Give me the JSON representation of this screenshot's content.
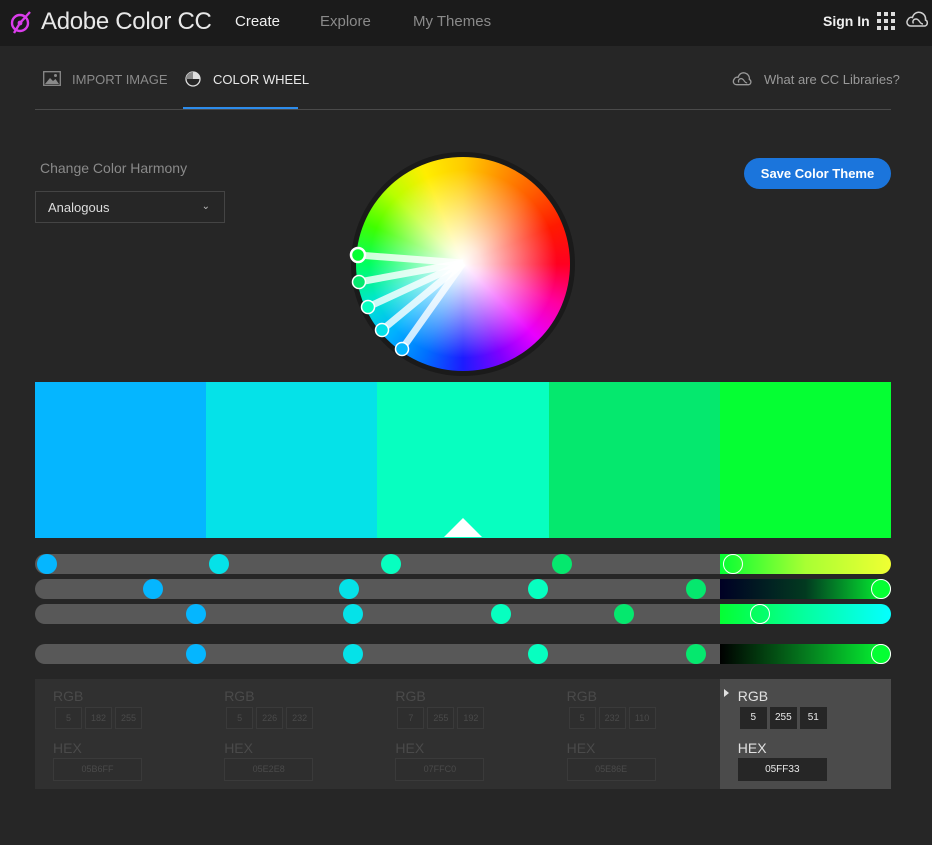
{
  "app": {
    "title": "Adobe Color CC"
  },
  "nav": {
    "create": "Create",
    "explore": "Explore",
    "my_themes": "My Themes",
    "sign_in": "Sign In"
  },
  "tabs": {
    "import_image": "IMPORT IMAGE",
    "color_wheel": "COLOR WHEEL",
    "active": "COLOR WHEEL",
    "cc_libraries": "What are CC Libraries?"
  },
  "harmony": {
    "label": "Change Color Harmony",
    "selected": "Analogous"
  },
  "save_button": "Save Color Theme",
  "colors": {
    "accent": "#1B75DC",
    "tab_underline": "#2D8CEB",
    "background": "#262626",
    "topbar": "#1B1B1B",
    "logo": "#DA3DEB"
  },
  "swatches": [
    {
      "hex": "05B6FF",
      "rgb": [
        "5",
        "182",
        "255"
      ],
      "css": "#05B6FF"
    },
    {
      "hex": "05E2E8",
      "rgb": [
        "5",
        "226",
        "232"
      ],
      "css": "#05E2E8"
    },
    {
      "hex": "07FFC0",
      "rgb": [
        "7",
        "255",
        "192"
      ],
      "css": "#07FFC0"
    },
    {
      "hex": "05E86E",
      "rgb": [
        "5",
        "232",
        "110"
      ],
      "css": "#05E86E"
    },
    {
      "hex": "05FF33",
      "rgb": [
        "5",
        "255",
        "51"
      ],
      "css": "#05FF33"
    }
  ],
  "base_swatch_index": 2,
  "selected_swatch_index": 4,
  "labels": {
    "rgb": "RGB",
    "hex": "HEX"
  },
  "icons": {
    "logo": "adobe-color-logo-icon",
    "import": "image-icon",
    "wheel": "color-wheel-icon",
    "apps": "apps-grid-icon",
    "cc": "creative-cloud-icon",
    "dropdown": "chevron-down-icon"
  }
}
